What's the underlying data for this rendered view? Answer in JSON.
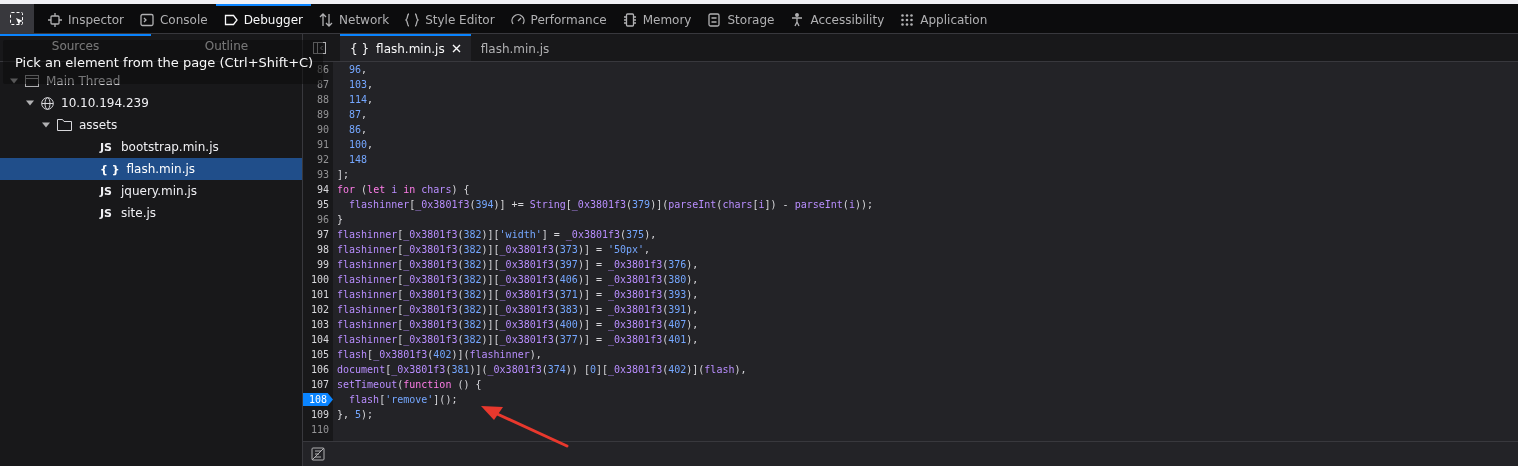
{
  "toolbar": {
    "tabs": [
      {
        "label": "Inspector",
        "selected": false
      },
      {
        "label": "Console",
        "selected": false
      },
      {
        "label": "Debugger",
        "selected": true
      },
      {
        "label": "Network",
        "selected": false
      },
      {
        "label": "Style Editor",
        "selected": false
      },
      {
        "label": "Performance",
        "selected": false
      },
      {
        "label": "Memory",
        "selected": false
      },
      {
        "label": "Storage",
        "selected": false
      },
      {
        "label": "Accessibility",
        "selected": false
      },
      {
        "label": "Application",
        "selected": false
      }
    ]
  },
  "tooltip": "Pick an element from the page (Ctrl+Shift+C)",
  "sidebar": {
    "tabs": [
      {
        "label": "Sources",
        "selected": true
      },
      {
        "label": "Outline",
        "selected": false
      }
    ],
    "tree": [
      {
        "label": "Main Thread",
        "kind": "thread",
        "expanded": true,
        "selected": false,
        "children": [
          {
            "label": "10.10.194.239",
            "kind": "host",
            "expanded": true,
            "selected": false,
            "children": [
              {
                "label": "assets",
                "kind": "folder",
                "expanded": true,
                "selected": false,
                "children": [
                  {
                    "label": "bootstrap.min.js",
                    "badge": "JS",
                    "selected": false
                  },
                  {
                    "label": "flash.min.js",
                    "badge": "{ }",
                    "selected": true
                  },
                  {
                    "label": "jquery.min.js",
                    "badge": "JS",
                    "selected": false
                  },
                  {
                    "label": "site.js",
                    "badge": "JS",
                    "selected": false
                  }
                ]
              }
            ]
          }
        ]
      }
    ]
  },
  "editor": {
    "tabs": [
      {
        "badge": "{ }",
        "label": "flash.min.js",
        "selected": true,
        "closable": true
      },
      {
        "label": "flash.min.js",
        "selected": false,
        "closable": false
      }
    ],
    "lines": [
      {
        "number": "86",
        "indent": true,
        "covered": false,
        "breakpoint": false,
        "tokens": [
          {
            "kind": "n",
            "text": "96"
          },
          {
            "kind": "p",
            "text": ","
          }
        ]
      },
      {
        "number": "87",
        "indent": true,
        "covered": false,
        "breakpoint": false,
        "tokens": [
          {
            "kind": "n",
            "text": "103"
          },
          {
            "kind": "p",
            "text": ","
          }
        ]
      },
      {
        "number": "88",
        "indent": true,
        "covered": false,
        "breakpoint": false,
        "tokens": [
          {
            "kind": "n",
            "text": "114"
          },
          {
            "kind": "p",
            "text": ","
          }
        ]
      },
      {
        "number": "89",
        "indent": true,
        "covered": false,
        "breakpoint": false,
        "tokens": [
          {
            "kind": "n",
            "text": "87"
          },
          {
            "kind": "p",
            "text": ","
          }
        ]
      },
      {
        "number": "90",
        "indent": true,
        "covered": false,
        "breakpoint": false,
        "tokens": [
          {
            "kind": "n",
            "text": "86"
          },
          {
            "kind": "p",
            "text": ","
          }
        ]
      },
      {
        "number": "91",
        "indent": true,
        "covered": false,
        "breakpoint": false,
        "tokens": [
          {
            "kind": "n",
            "text": "100"
          },
          {
            "kind": "p",
            "text": ","
          }
        ]
      },
      {
        "number": "92",
        "indent": true,
        "covered": false,
        "breakpoint": false,
        "tokens": [
          {
            "kind": "n",
            "text": "148"
          }
        ]
      },
      {
        "number": "93",
        "indent": false,
        "covered": false,
        "breakpoint": false,
        "tokens": [
          {
            "kind": "p",
            "text": "];"
          }
        ]
      },
      {
        "number": "94",
        "indent": false,
        "covered": true,
        "breakpoint": false,
        "tokens": [
          {
            "kind": "k",
            "text": "for"
          },
          {
            "kind": "p",
            "text": " ("
          },
          {
            "kind": "k",
            "text": "let"
          },
          {
            "kind": "i",
            "text": " i "
          },
          {
            "kind": "k",
            "text": "in"
          },
          {
            "kind": "i",
            "text": " chars"
          },
          {
            "kind": "p",
            "text": ") {"
          }
        ]
      },
      {
        "number": "95",
        "indent": true,
        "covered": true,
        "breakpoint": false,
        "tokens": [
          {
            "kind": "i",
            "text": "flashinner"
          },
          {
            "kind": "p",
            "text": "["
          },
          {
            "kind": "i",
            "text": "_0x3801f3"
          },
          {
            "kind": "p",
            "text": "("
          },
          {
            "kind": "n",
            "text": "394"
          },
          {
            "kind": "p",
            "text": ")] += "
          },
          {
            "kind": "i",
            "text": "String"
          },
          {
            "kind": "p",
            "text": "["
          },
          {
            "kind": "i",
            "text": "_0x3801f3"
          },
          {
            "kind": "p",
            "text": "("
          },
          {
            "kind": "n",
            "text": "379"
          },
          {
            "kind": "p",
            "text": ")]("
          },
          {
            "kind": "i",
            "text": "parseInt"
          },
          {
            "kind": "p",
            "text": "("
          },
          {
            "kind": "i",
            "text": "chars"
          },
          {
            "kind": "p",
            "text": "["
          },
          {
            "kind": "i",
            "text": "i"
          },
          {
            "kind": "p",
            "text": "]) - "
          },
          {
            "kind": "i",
            "text": "parseInt"
          },
          {
            "kind": "p",
            "text": "("
          },
          {
            "kind": "i",
            "text": "i"
          },
          {
            "kind": "p",
            "text": "));"
          }
        ]
      },
      {
        "number": "96",
        "indent": false,
        "covered": false,
        "breakpoint": false,
        "tokens": [
          {
            "kind": "p",
            "text": "}"
          }
        ]
      },
      {
        "number": "97",
        "indent": false,
        "covered": true,
        "breakpoint": false,
        "tokens": [
          {
            "kind": "i",
            "text": "flashinner"
          },
          {
            "kind": "p",
            "text": "["
          },
          {
            "kind": "i",
            "text": "_0x3801f3"
          },
          {
            "kind": "p",
            "text": "("
          },
          {
            "kind": "n",
            "text": "382"
          },
          {
            "kind": "p",
            "text": ")]["
          },
          {
            "kind": "n",
            "text": "'width'"
          },
          {
            "kind": "p",
            "text": "] = "
          },
          {
            "kind": "i",
            "text": "_0x3801f3"
          },
          {
            "kind": "p",
            "text": "("
          },
          {
            "kind": "n",
            "text": "375"
          },
          {
            "kind": "p",
            "text": "),"
          }
        ]
      },
      {
        "number": "98",
        "indent": false,
        "covered": true,
        "breakpoint": false,
        "tokens": [
          {
            "kind": "i",
            "text": "flashinner"
          },
          {
            "kind": "p",
            "text": "["
          },
          {
            "kind": "i",
            "text": "_0x3801f3"
          },
          {
            "kind": "p",
            "text": "("
          },
          {
            "kind": "n",
            "text": "382"
          },
          {
            "kind": "p",
            "text": ")]["
          },
          {
            "kind": "i",
            "text": "_0x3801f3"
          },
          {
            "kind": "p",
            "text": "("
          },
          {
            "kind": "n",
            "text": "373"
          },
          {
            "kind": "p",
            "text": ")] = "
          },
          {
            "kind": "n",
            "text": "'50px'"
          },
          {
            "kind": "p",
            "text": ","
          }
        ]
      },
      {
        "number": "99",
        "indent": false,
        "covered": true,
        "breakpoint": false,
        "tokens": [
          {
            "kind": "i",
            "text": "flashinner"
          },
          {
            "kind": "p",
            "text": "["
          },
          {
            "kind": "i",
            "text": "_0x3801f3"
          },
          {
            "kind": "p",
            "text": "("
          },
          {
            "kind": "n",
            "text": "382"
          },
          {
            "kind": "p",
            "text": ")]["
          },
          {
            "kind": "i",
            "text": "_0x3801f3"
          },
          {
            "kind": "p",
            "text": "("
          },
          {
            "kind": "n",
            "text": "397"
          },
          {
            "kind": "p",
            "text": ")] = "
          },
          {
            "kind": "i",
            "text": "_0x3801f3"
          },
          {
            "kind": "p",
            "text": "("
          },
          {
            "kind": "n",
            "text": "376"
          },
          {
            "kind": "p",
            "text": "),"
          }
        ]
      },
      {
        "number": "100",
        "indent": false,
        "covered": true,
        "breakpoint": false,
        "tokens": [
          {
            "kind": "i",
            "text": "flashinner"
          },
          {
            "kind": "p",
            "text": "["
          },
          {
            "kind": "i",
            "text": "_0x3801f3"
          },
          {
            "kind": "p",
            "text": "("
          },
          {
            "kind": "n",
            "text": "382"
          },
          {
            "kind": "p",
            "text": ")]["
          },
          {
            "kind": "i",
            "text": "_0x3801f3"
          },
          {
            "kind": "p",
            "text": "("
          },
          {
            "kind": "n",
            "text": "406"
          },
          {
            "kind": "p",
            "text": ")] = "
          },
          {
            "kind": "i",
            "text": "_0x3801f3"
          },
          {
            "kind": "p",
            "text": "("
          },
          {
            "kind": "n",
            "text": "380"
          },
          {
            "kind": "p",
            "text": "),"
          }
        ]
      },
      {
        "number": "101",
        "indent": false,
        "covered": true,
        "breakpoint": false,
        "tokens": [
          {
            "kind": "i",
            "text": "flashinner"
          },
          {
            "kind": "p",
            "text": "["
          },
          {
            "kind": "i",
            "text": "_0x3801f3"
          },
          {
            "kind": "p",
            "text": "("
          },
          {
            "kind": "n",
            "text": "382"
          },
          {
            "kind": "p",
            "text": ")]["
          },
          {
            "kind": "i",
            "text": "_0x3801f3"
          },
          {
            "kind": "p",
            "text": "("
          },
          {
            "kind": "n",
            "text": "371"
          },
          {
            "kind": "p",
            "text": ")] = "
          },
          {
            "kind": "i",
            "text": "_0x3801f3"
          },
          {
            "kind": "p",
            "text": "("
          },
          {
            "kind": "n",
            "text": "393"
          },
          {
            "kind": "p",
            "text": "),"
          }
        ]
      },
      {
        "number": "102",
        "indent": false,
        "covered": true,
        "breakpoint": false,
        "tokens": [
          {
            "kind": "i",
            "text": "flashinner"
          },
          {
            "kind": "p",
            "text": "["
          },
          {
            "kind": "i",
            "text": "_0x3801f3"
          },
          {
            "kind": "p",
            "text": "("
          },
          {
            "kind": "n",
            "text": "382"
          },
          {
            "kind": "p",
            "text": ")]["
          },
          {
            "kind": "i",
            "text": "_0x3801f3"
          },
          {
            "kind": "p",
            "text": "("
          },
          {
            "kind": "n",
            "text": "383"
          },
          {
            "kind": "p",
            "text": ")] = "
          },
          {
            "kind": "i",
            "text": "_0x3801f3"
          },
          {
            "kind": "p",
            "text": "("
          },
          {
            "kind": "n",
            "text": "391"
          },
          {
            "kind": "p",
            "text": "),"
          }
        ]
      },
      {
        "number": "103",
        "indent": false,
        "covered": true,
        "breakpoint": false,
        "tokens": [
          {
            "kind": "i",
            "text": "flashinner"
          },
          {
            "kind": "p",
            "text": "["
          },
          {
            "kind": "i",
            "text": "_0x3801f3"
          },
          {
            "kind": "p",
            "text": "("
          },
          {
            "kind": "n",
            "text": "382"
          },
          {
            "kind": "p",
            "text": ")]["
          },
          {
            "kind": "i",
            "text": "_0x3801f3"
          },
          {
            "kind": "p",
            "text": "("
          },
          {
            "kind": "n",
            "text": "400"
          },
          {
            "kind": "p",
            "text": ")] = "
          },
          {
            "kind": "i",
            "text": "_0x3801f3"
          },
          {
            "kind": "p",
            "text": "("
          },
          {
            "kind": "n",
            "text": "407"
          },
          {
            "kind": "p",
            "text": "),"
          }
        ]
      },
      {
        "number": "104",
        "indent": false,
        "covered": true,
        "breakpoint": false,
        "tokens": [
          {
            "kind": "i",
            "text": "flashinner"
          },
          {
            "kind": "p",
            "text": "["
          },
          {
            "kind": "i",
            "text": "_0x3801f3"
          },
          {
            "kind": "p",
            "text": "("
          },
          {
            "kind": "n",
            "text": "382"
          },
          {
            "kind": "p",
            "text": ")]["
          },
          {
            "kind": "i",
            "text": "_0x3801f3"
          },
          {
            "kind": "p",
            "text": "("
          },
          {
            "kind": "n",
            "text": "377"
          },
          {
            "kind": "p",
            "text": ")] = "
          },
          {
            "kind": "i",
            "text": "_0x3801f3"
          },
          {
            "kind": "p",
            "text": "("
          },
          {
            "kind": "n",
            "text": "401"
          },
          {
            "kind": "p",
            "text": "),"
          }
        ]
      },
      {
        "number": "105",
        "indent": false,
        "covered": true,
        "breakpoint": false,
        "tokens": [
          {
            "kind": "i",
            "text": "flash"
          },
          {
            "kind": "p",
            "text": "["
          },
          {
            "kind": "i",
            "text": "_0x3801f3"
          },
          {
            "kind": "p",
            "text": "("
          },
          {
            "kind": "n",
            "text": "402"
          },
          {
            "kind": "p",
            "text": ")]("
          },
          {
            "kind": "i",
            "text": "flashinner"
          },
          {
            "kind": "p",
            "text": "),"
          }
        ]
      },
      {
        "number": "106",
        "indent": false,
        "covered": true,
        "breakpoint": false,
        "tokens": [
          {
            "kind": "i",
            "text": "document"
          },
          {
            "kind": "p",
            "text": "["
          },
          {
            "kind": "i",
            "text": "_0x3801f3"
          },
          {
            "kind": "p",
            "text": "("
          },
          {
            "kind": "n",
            "text": "381"
          },
          {
            "kind": "p",
            "text": ")]("
          },
          {
            "kind": "i",
            "text": "_0x3801f3"
          },
          {
            "kind": "p",
            "text": "("
          },
          {
            "kind": "n",
            "text": "374"
          },
          {
            "kind": "p",
            "text": ")) ["
          },
          {
            "kind": "n",
            "text": "0"
          },
          {
            "kind": "p",
            "text": "]["
          },
          {
            "kind": "i",
            "text": "_0x3801f3"
          },
          {
            "kind": "p",
            "text": "("
          },
          {
            "kind": "n",
            "text": "402"
          },
          {
            "kind": "p",
            "text": ")]("
          },
          {
            "kind": "i",
            "text": "flash"
          },
          {
            "kind": "p",
            "text": "),"
          }
        ]
      },
      {
        "number": "107",
        "indent": false,
        "covered": true,
        "breakpoint": false,
        "tokens": [
          {
            "kind": "i",
            "text": "setTimeout"
          },
          {
            "kind": "p",
            "text": "("
          },
          {
            "kind": "k",
            "text": "function"
          },
          {
            "kind": "p",
            "text": " () {"
          }
        ]
      },
      {
        "number": "108",
        "indent": true,
        "covered": true,
        "breakpoint": true,
        "tokens": [
          {
            "kind": "i",
            "text": "flash"
          },
          {
            "kind": "p",
            "text": "["
          },
          {
            "kind": "n",
            "text": "'remove'"
          },
          {
            "kind": "p",
            "text": "]();"
          }
        ]
      },
      {
        "number": "109",
        "indent": false,
        "covered": true,
        "breakpoint": false,
        "tokens": [
          {
            "kind": "p",
            "text": "}, "
          },
          {
            "kind": "n",
            "text": "5"
          },
          {
            "kind": "p",
            "text": ");"
          }
        ]
      },
      {
        "number": "110",
        "covered": false,
        "breakpoint": false
      }
    ]
  }
}
